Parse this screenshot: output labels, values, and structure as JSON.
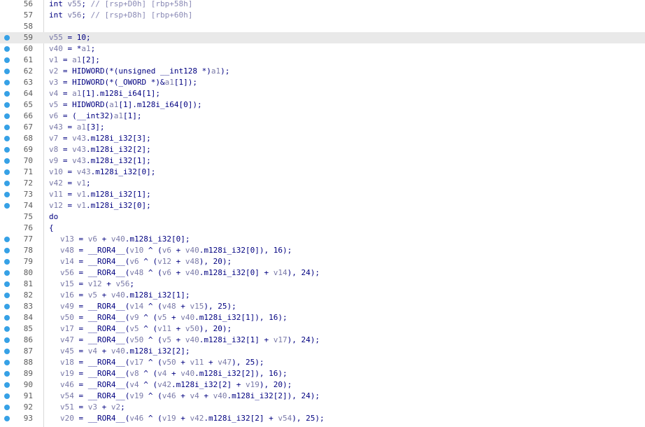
{
  "colors": {
    "breakpoint": "#36a1e6",
    "code": "#000080",
    "variable": "#7a7aa8",
    "comment": "#8a8ab5",
    "highlight": "#e9e9e9"
  },
  "lines": [
    {
      "n": "56",
      "bp": false,
      "hl": false,
      "indent": 0,
      "text": "int v55; // [rsp+D0h] [rbp+58h]"
    },
    {
      "n": "57",
      "bp": false,
      "hl": false,
      "indent": 0,
      "text": "int v56; // [rsp+D8h] [rbp+60h]"
    },
    {
      "n": "58",
      "bp": false,
      "hl": false,
      "indent": 0,
      "text": ""
    },
    {
      "n": "59",
      "bp": true,
      "hl": true,
      "indent": 0,
      "text": "v55 = 10;"
    },
    {
      "n": "60",
      "bp": true,
      "hl": false,
      "indent": 0,
      "text": "v40 = *a1;"
    },
    {
      "n": "61",
      "bp": true,
      "hl": false,
      "indent": 0,
      "text": "v1 = a1[2];"
    },
    {
      "n": "62",
      "bp": true,
      "hl": false,
      "indent": 0,
      "text": "v2 = HIDWORD(*(unsigned __int128 *)a1);"
    },
    {
      "n": "63",
      "bp": true,
      "hl": false,
      "indent": 0,
      "text": "v3 = HIDWORD(*(_OWORD *)&a1[1]);"
    },
    {
      "n": "64",
      "bp": true,
      "hl": false,
      "indent": 0,
      "text": "v4 = a1[1].m128i_i64[1];"
    },
    {
      "n": "65",
      "bp": true,
      "hl": false,
      "indent": 0,
      "text": "v5 = HIDWORD(a1[1].m128i_i64[0]);"
    },
    {
      "n": "66",
      "bp": true,
      "hl": false,
      "indent": 0,
      "text": "v6 = (__int32)a1[1];"
    },
    {
      "n": "67",
      "bp": true,
      "hl": false,
      "indent": 0,
      "text": "v43 = a1[3];"
    },
    {
      "n": "68",
      "bp": true,
      "hl": false,
      "indent": 0,
      "text": "v7 = v43.m128i_i32[3];"
    },
    {
      "n": "69",
      "bp": true,
      "hl": false,
      "indent": 0,
      "text": "v8 = v43.m128i_i32[2];"
    },
    {
      "n": "70",
      "bp": true,
      "hl": false,
      "indent": 0,
      "text": "v9 = v43.m128i_i32[1];"
    },
    {
      "n": "71",
      "bp": true,
      "hl": false,
      "indent": 0,
      "text": "v10 = v43.m128i_i32[0];"
    },
    {
      "n": "72",
      "bp": true,
      "hl": false,
      "indent": 0,
      "text": "v42 = v1;"
    },
    {
      "n": "73",
      "bp": true,
      "hl": false,
      "indent": 0,
      "text": "v11 = v1.m128i_i32[1];"
    },
    {
      "n": "74",
      "bp": true,
      "hl": false,
      "indent": 0,
      "text": "v12 = v1.m128i_i32[0];"
    },
    {
      "n": "75",
      "bp": false,
      "hl": false,
      "indent": 0,
      "text": "do"
    },
    {
      "n": "76",
      "bp": false,
      "hl": false,
      "indent": 0,
      "text": "{"
    },
    {
      "n": "77",
      "bp": true,
      "hl": false,
      "indent": 1,
      "text": "v13 = v6 + v40.m128i_i32[0];"
    },
    {
      "n": "78",
      "bp": true,
      "hl": false,
      "indent": 1,
      "text": "v48 = __ROR4__(v10 ^ (v6 + v40.m128i_i32[0]), 16);"
    },
    {
      "n": "79",
      "bp": true,
      "hl": false,
      "indent": 1,
      "text": "v14 = __ROR4__(v6 ^ (v12 + v48), 20);"
    },
    {
      "n": "80",
      "bp": true,
      "hl": false,
      "indent": 1,
      "text": "v56 = __ROR4__(v48 ^ (v6 + v40.m128i_i32[0] + v14), 24);"
    },
    {
      "n": "81",
      "bp": true,
      "hl": false,
      "indent": 1,
      "text": "v15 = v12 + v56;"
    },
    {
      "n": "82",
      "bp": true,
      "hl": false,
      "indent": 1,
      "text": "v16 = v5 + v40.m128i_i32[1];"
    },
    {
      "n": "83",
      "bp": true,
      "hl": false,
      "indent": 1,
      "text": "v49 = __ROR4__(v14 ^ (v48 + v15), 25);"
    },
    {
      "n": "84",
      "bp": true,
      "hl": false,
      "indent": 1,
      "text": "v50 = __ROR4__(v9 ^ (v5 + v40.m128i_i32[1]), 16);"
    },
    {
      "n": "85",
      "bp": true,
      "hl": false,
      "indent": 1,
      "text": "v17 = __ROR4__(v5 ^ (v11 + v50), 20);"
    },
    {
      "n": "86",
      "bp": true,
      "hl": false,
      "indent": 1,
      "text": "v47 = __ROR4__(v50 ^ (v5 + v40.m128i_i32[1] + v17), 24);"
    },
    {
      "n": "87",
      "bp": true,
      "hl": false,
      "indent": 1,
      "text": "v45 = v4 + v40.m128i_i32[2];"
    },
    {
      "n": "88",
      "bp": true,
      "hl": false,
      "indent": 1,
      "text": "v18 = __ROR4__(v17 ^ (v50 + v11 + v47), 25);"
    },
    {
      "n": "89",
      "bp": true,
      "hl": false,
      "indent": 1,
      "text": "v19 = __ROR4__(v8 ^ (v4 + v40.m128i_i32[2]), 16);"
    },
    {
      "n": "90",
      "bp": true,
      "hl": false,
      "indent": 1,
      "text": "v46 = __ROR4__(v4 ^ (v42.m128i_i32[2] + v19), 20);"
    },
    {
      "n": "91",
      "bp": true,
      "hl": false,
      "indent": 1,
      "text": "v54 = __ROR4__(v19 ^ (v46 + v4 + v40.m128i_i32[2]), 24);"
    },
    {
      "n": "92",
      "bp": true,
      "hl": false,
      "indent": 1,
      "text": "v51 = v3 + v2;"
    },
    {
      "n": "93",
      "bp": true,
      "hl": false,
      "indent": 1,
      "text": "v20 = __ROR4__(v46 ^ (v19 + v42.m128i_i32[2] + v54), 25);"
    }
  ]
}
